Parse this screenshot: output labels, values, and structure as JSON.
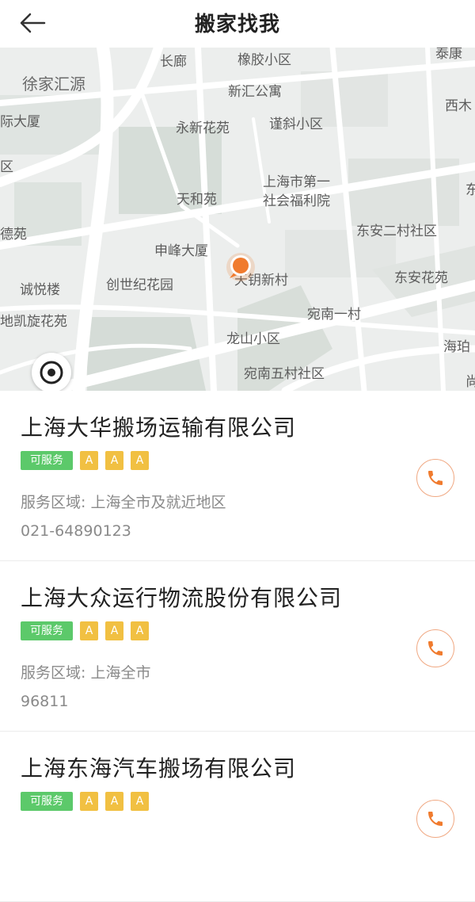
{
  "header": {
    "title": "搬家找我"
  },
  "map": {
    "labels": [
      "长廊",
      "橡胶小区",
      "泰康",
      "徐家汇源",
      "新汇公寓",
      "西木",
      "际大厦",
      "永新花苑",
      "谨斜小区",
      "区",
      "上海市第一",
      "社会福利院",
      "天和苑",
      "东安二村社区",
      "德苑",
      "申峰大厦",
      "诚悦楼",
      "创世纪花园",
      "天钥新村",
      "东安花苑",
      "地凯旋花苑",
      "宛南一村",
      "龙山小区",
      "海珀",
      "宛南五村社区",
      "东",
      "尚"
    ]
  },
  "companies": [
    {
      "name": "上海大华搬场运输有限公司",
      "status": "可服务",
      "rating": [
        "A",
        "A",
        "A"
      ],
      "area": "服务区域: 上海全市及就近地区",
      "phone": "021-64890123"
    },
    {
      "name": "上海大众运行物流股份有限公司",
      "status": "可服务",
      "rating": [
        "A",
        "A",
        "A"
      ],
      "area": "服务区域: 上海全市",
      "phone": "96811"
    },
    {
      "name": "上海东海汽车搬场有限公司",
      "status": "可服务",
      "rating": [
        "A",
        "A",
        "A"
      ],
      "area": "",
      "phone": ""
    }
  ],
  "colors": {
    "accent": "#f07b2e",
    "serviceable": "#5cc96a",
    "rating": "#f1c042"
  },
  "icons": {
    "back": "arrow-left-icon",
    "locate": "locate-icon",
    "pin": "location-pin-icon",
    "call": "phone-icon"
  }
}
